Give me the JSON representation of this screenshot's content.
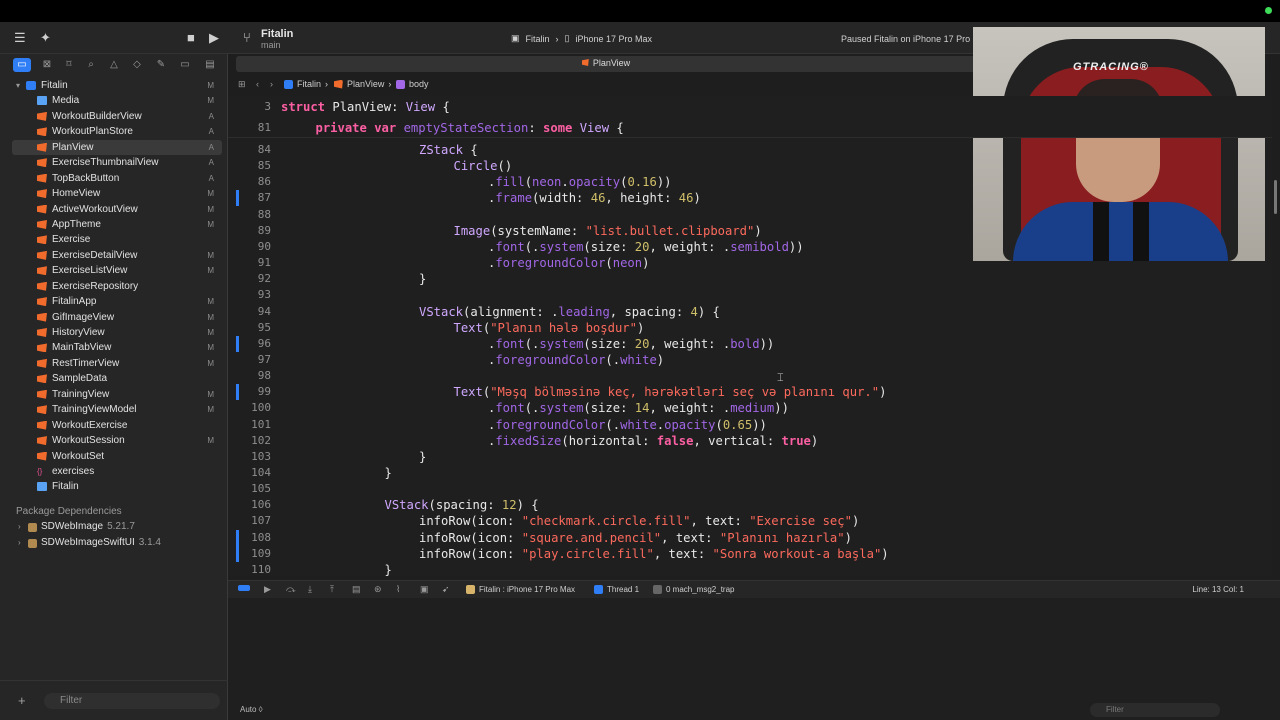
{
  "toolbar": {
    "project_title": "Fitalin",
    "branch": "main",
    "scheme_target": "Fitalin",
    "scheme_device": "iPhone 17 Pro Max",
    "status": "Paused Fitalin on iPhone 17 Pro M"
  },
  "tab": {
    "label": "PlanView"
  },
  "jumpbar": {
    "project": "Fitalin",
    "file": "PlanView",
    "symbol": "body"
  },
  "navigator": {
    "root": "Fitalin",
    "items": [
      {
        "name": "Media",
        "kind": "folder",
        "badge": "M"
      },
      {
        "name": "WorkoutBuilderView",
        "kind": "swift",
        "badge": "A"
      },
      {
        "name": "WorkoutPlanStore",
        "kind": "swift",
        "badge": "A"
      },
      {
        "name": "PlanView",
        "kind": "swift",
        "badge": "A",
        "selected": true
      },
      {
        "name": "ExerciseThumbnailView",
        "kind": "swift",
        "badge": "A"
      },
      {
        "name": "TopBackButton",
        "kind": "swift",
        "badge": "A"
      },
      {
        "name": "HomeView",
        "kind": "swift",
        "badge": "M"
      },
      {
        "name": "ActiveWorkoutView",
        "kind": "swift",
        "badge": "M"
      },
      {
        "name": "AppTheme",
        "kind": "swift",
        "badge": "M"
      },
      {
        "name": "Exercise",
        "kind": "swift",
        "badge": ""
      },
      {
        "name": "ExerciseDetailView",
        "kind": "swift",
        "badge": "M"
      },
      {
        "name": "ExerciseListView",
        "kind": "swift",
        "badge": "M"
      },
      {
        "name": "ExerciseRepository",
        "kind": "swift",
        "badge": ""
      },
      {
        "name": "FitalinApp",
        "kind": "swift",
        "badge": "M"
      },
      {
        "name": "GifImageView",
        "kind": "swift",
        "badge": "M"
      },
      {
        "name": "HistoryView",
        "kind": "swift",
        "badge": "M"
      },
      {
        "name": "MainTabView",
        "kind": "swift",
        "badge": "M"
      },
      {
        "name": "RestTimerView",
        "kind": "swift",
        "badge": "M"
      },
      {
        "name": "SampleData",
        "kind": "swift",
        "badge": ""
      },
      {
        "name": "TrainingView",
        "kind": "swift",
        "badge": "M"
      },
      {
        "name": "TrainingViewModel",
        "kind": "swift",
        "badge": "M"
      },
      {
        "name": "WorkoutExercise",
        "kind": "swift",
        "badge": ""
      },
      {
        "name": "WorkoutSession",
        "kind": "swift",
        "badge": "M"
      },
      {
        "name": "WorkoutSet",
        "kind": "swift",
        "badge": ""
      },
      {
        "name": "exercises",
        "kind": "json",
        "badge": ""
      },
      {
        "name": "Fitalin",
        "kind": "folder",
        "badge": ""
      }
    ],
    "packages_header": "Package Dependencies",
    "packages": [
      {
        "name": "SDWebImage",
        "version": "5.21.7"
      },
      {
        "name": "SDWebImageSwiftUI",
        "version": "3.1.4"
      }
    ],
    "filter_placeholder": "Filter"
  },
  "editor": {
    "sticky": [
      {
        "num": "3",
        "text": "struct PlanView: View {",
        "indent": 0
      },
      {
        "num": "81",
        "text": "private var emptyStateSection: some View {",
        "indent": 1
      }
    ],
    "lines": [
      {
        "num": "84",
        "text": "ZStack {",
        "indent": 4,
        "mark": false
      },
      {
        "num": "85",
        "text": "Circle()",
        "indent": 5,
        "mark": false
      },
      {
        "num": "86",
        "text": ".fill(neon.opacity(0.16))",
        "indent": 6,
        "mark": false
      },
      {
        "num": "87",
        "text": ".frame(width: 46, height: 46)",
        "indent": 6,
        "mark": true
      },
      {
        "num": "88",
        "text": "",
        "indent": 0,
        "mark": false
      },
      {
        "num": "89",
        "text": "Image(systemName: \"list.bullet.clipboard\")",
        "indent": 5,
        "mark": false
      },
      {
        "num": "90",
        "text": ".font(.system(size: 20, weight: .semibold))",
        "indent": 6,
        "mark": false
      },
      {
        "num": "91",
        "text": ".foregroundColor(neon)",
        "indent": 6,
        "mark": false
      },
      {
        "num": "92",
        "text": "}",
        "indent": 4,
        "mark": false
      },
      {
        "num": "93",
        "text": "",
        "indent": 0,
        "mark": false
      },
      {
        "num": "94",
        "text": "VStack(alignment: .leading, spacing: 4) {",
        "indent": 4,
        "mark": false
      },
      {
        "num": "95",
        "text": "Text(\"Planın hələ boşdur\")",
        "indent": 5,
        "mark": false
      },
      {
        "num": "96",
        "text": ".font(.system(size: 20, weight: .bold))",
        "indent": 6,
        "mark": true
      },
      {
        "num": "97",
        "text": ".foregroundColor(.white)",
        "indent": 6,
        "mark": false
      },
      {
        "num": "98",
        "text": "",
        "indent": 0,
        "mark": false
      },
      {
        "num": "99",
        "text": "Text(\"Məşq bölməsinə keç, hərəkətləri seç və planını qur.\")",
        "indent": 5,
        "mark": true
      },
      {
        "num": "100",
        "text": ".font(.system(size: 14, weight: .medium))",
        "indent": 6,
        "mark": false
      },
      {
        "num": "101",
        "text": ".foregroundColor(.white.opacity(0.65))",
        "indent": 6,
        "mark": false
      },
      {
        "num": "102",
        "text": ".fixedSize(horizontal: false, vertical: true)",
        "indent": 6,
        "mark": false
      },
      {
        "num": "103",
        "text": "}",
        "indent": 4,
        "mark": false
      },
      {
        "num": "104",
        "text": "}",
        "indent": 3,
        "mark": false
      },
      {
        "num": "105",
        "text": "",
        "indent": 0,
        "mark": false
      },
      {
        "num": "106",
        "text": "VStack(spacing: 12) {",
        "indent": 3,
        "mark": false
      },
      {
        "num": "107",
        "text": "infoRow(icon: \"checkmark.circle.fill\", text: \"Exercise seç\")",
        "indent": 4,
        "mark": false
      },
      {
        "num": "108",
        "text": "infoRow(icon: \"square.and.pencil\", text: \"Planını hazırla\")",
        "indent": 4,
        "mark": true
      },
      {
        "num": "109",
        "text": "infoRow(icon: \"play.circle.fill\", text: \"Sonra workout-a başla\")",
        "indent": 4,
        "mark": true
      },
      {
        "num": "110",
        "text": "}",
        "indent": 3,
        "mark": false
      }
    ]
  },
  "debugbar": {
    "target": "Fitalin : iPhone 17 Pro Max",
    "thread": "Thread 1",
    "frame": "0 mach_msg2_trap",
    "position": "Line: 13  Col: 1"
  },
  "console": {
    "mode": "Auto ◊",
    "filter_placeholder": "Filter"
  },
  "webcam": {
    "brand": "GTRACING®"
  },
  "colors": {
    "keyword": "#fc5fa3",
    "type": "#d0a8ff",
    "string": "#fc6a5d",
    "number": "#d0bf69",
    "member": "#a167e6",
    "accent": "#2f7ef6"
  }
}
